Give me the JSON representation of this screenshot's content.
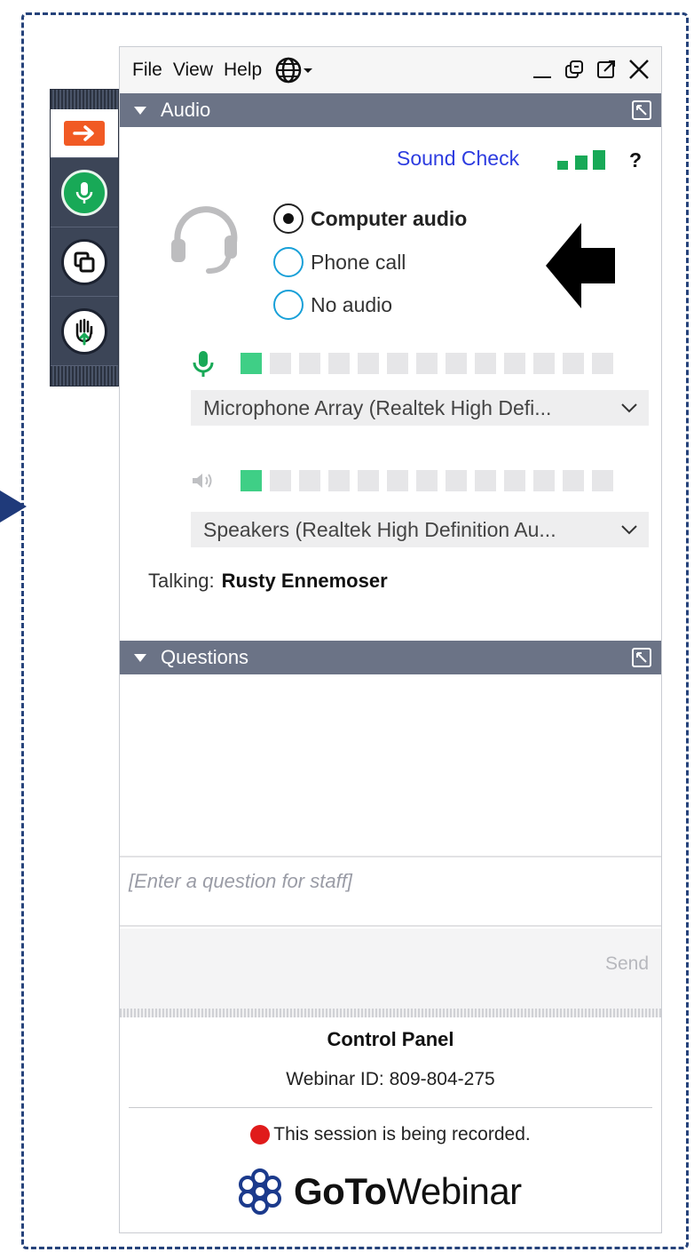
{
  "menu": {
    "file": "File",
    "view": "View",
    "help": "Help"
  },
  "audio": {
    "section_title": "Audio",
    "sound_check": "Sound Check",
    "help": "?",
    "options": [
      {
        "label": "Computer audio",
        "selected": true
      },
      {
        "label": "Phone call",
        "selected": false
      },
      {
        "label": "No audio",
        "selected": false
      }
    ],
    "microphone": {
      "device": "Microphone Array (Realtek High Defi...",
      "level_cells_on": 1,
      "level_cells_total": 13
    },
    "speakers": {
      "device": "Speakers (Realtek High Definition Au...",
      "level_cells_on": 1,
      "level_cells_total": 13
    },
    "talking_label": "Talking:",
    "talking_name": "Rusty Ennemoser"
  },
  "questions": {
    "section_title": "Questions",
    "placeholder": "[Enter a question for staff]",
    "send": "Send"
  },
  "control_panel": {
    "title": "Control Panel",
    "webinar_id": "Webinar ID: 809-804-275",
    "recording": "This session is being recorded.",
    "logo_goto": "GoTo",
    "logo_webinar": "Webinar"
  },
  "colors": {
    "accent_orange": "#f15a24",
    "mic_green": "#18a957",
    "meter_green": "#3fcf86",
    "sound_check_blue": "#2d3ce0",
    "section_bar": "#6b7386",
    "record_red": "#e01b1b",
    "frame_navy": "#25427a"
  },
  "icons": [
    "exit-arrow-icon",
    "microphone-icon",
    "screen-share-icon",
    "raise-hand-icon",
    "globe-icon",
    "minimize-icon",
    "restore-icon",
    "popout-icon",
    "close-icon",
    "headset-icon",
    "speaker-icon",
    "chevron-down-icon",
    "gotowebinar-logo-icon"
  ]
}
